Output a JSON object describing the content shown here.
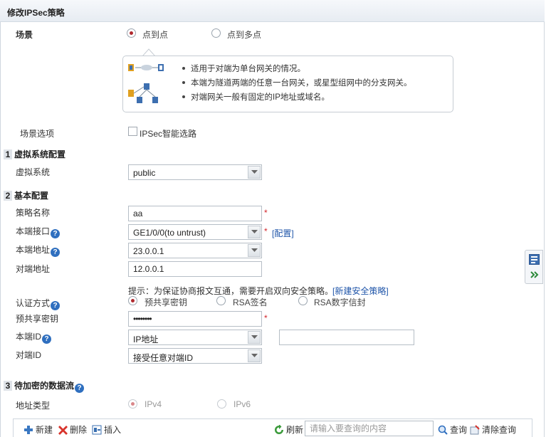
{
  "page": {
    "title": "修改IPSec策略"
  },
  "scene": {
    "label": "场景",
    "options": [
      {
        "label": "点到点",
        "selected": true
      },
      {
        "label": "点到多点",
        "selected": false
      }
    ]
  },
  "tip": {
    "lines": [
      "适用于对端为单台网关的情况。",
      "本端为隧道两端的任意一台网关，或星型组网中的分支网关。",
      "对端网关一般有固定的IP地址或域名。"
    ]
  },
  "scene_options": {
    "label": "场景选项",
    "checkbox_label": "IPSec智能选路",
    "checked": false
  },
  "section1": {
    "num": "1",
    "title": "虚拟系统配置",
    "vsys_label": "虚拟系统",
    "vsys_value": "public"
  },
  "section2": {
    "num": "2",
    "title": "基本配置",
    "policy_name_label": "策略名称",
    "policy_name_value": "aa",
    "local_if_label": "本端接口",
    "local_if_value": "GE1/0/0(to untrust)",
    "config_link": "[配置]",
    "local_addr_label": "本端地址",
    "local_addr_value": "23.0.0.1",
    "peer_addr_label": "对端地址",
    "peer_addr_value": "12.0.0.1",
    "hint_text": "提示：为保证协商报文互通，需要开启双向安全策略。",
    "hint_link": "[新建安全策略]",
    "auth_label": "认证方式",
    "auth_options": [
      {
        "label": "预共享密钥",
        "selected": true
      },
      {
        "label": "RSA签名",
        "selected": false
      },
      {
        "label": "RSA数字信封",
        "selected": false
      }
    ],
    "psk_label": "预共享密钥",
    "psk_value": "••••••••",
    "local_id_label": "本端ID",
    "local_id_value": "IP地址",
    "local_id_extra": "",
    "peer_id_label": "对端ID",
    "peer_id_value": "接受任意对端ID",
    "required_mark": "*",
    "help_glyph": "?"
  },
  "section3": {
    "num": "3",
    "title": "待加密的数据流",
    "addr_type_label": "地址类型",
    "addr_type_options": [
      {
        "label": "IPv4",
        "selected": true
      },
      {
        "label": "IPv6",
        "selected": false
      }
    ]
  },
  "toolbar": {
    "new_label": "新建",
    "delete_label": "删除",
    "insert_label": "插入",
    "refresh_label": "刷新",
    "search_placeholder": "请输入要查询的内容",
    "query_label": "查询",
    "clear_label": "清除查询"
  },
  "colors": {
    "accent_red": "#b0292e",
    "link_blue": "#1f55a9",
    "help_blue": "#2f6fbf"
  }
}
